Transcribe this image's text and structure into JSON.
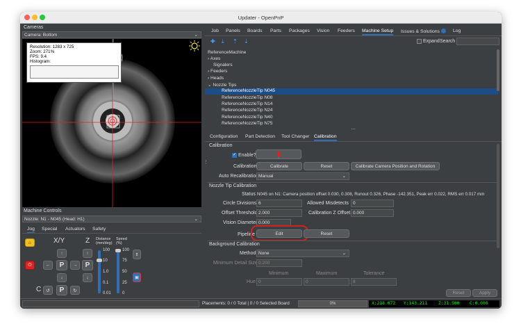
{
  "window": {
    "title": "Updater - OpenPnP"
  },
  "cameras": {
    "panel_label": "Cameras",
    "selected": "Camera: Bottom",
    "overlay": {
      "resolution": "Resolution: 1283 x 725",
      "zoom": "Zoom: 271%",
      "fps": "FPS: 9.4",
      "histogram": "Histogram:"
    }
  },
  "machine_controls": {
    "label": "Machine Controls",
    "nozzle": "Nozzle: N1 - N045 (Head: H1)",
    "tabs": [
      "Jog",
      "Special",
      "Actuators",
      "Safety"
    ],
    "xy": "X/Y",
    "z": "Z",
    "distance_label": "Distance\n(mm/deg)",
    "speed_label": "Speed\n(%)",
    "distance_ticks": [
      "100",
      "10",
      "1.0",
      "0.1",
      "0.01"
    ],
    "speed_ticks": [
      "100",
      "75",
      "50",
      "25",
      "0"
    ],
    "distance_value": 10,
    "speed_value": 100,
    "p": "P",
    "c": "C"
  },
  "top_tabs": [
    "Job",
    "Panels",
    "Boards",
    "Parts",
    "Packages",
    "Vision",
    "Feeders",
    "Machine Setup",
    "Issues & Solutions",
    "Log"
  ],
  "top_tab_selected": "Machine Setup",
  "toolbar": {
    "expand": "Expand",
    "search": "Search"
  },
  "tree": {
    "root": "ReferenceMachine",
    "items": [
      "Axes",
      "Signalers",
      "Feeders",
      "Heads",
      "Nozzle Tips"
    ],
    "nozzle_tips": [
      "ReferenceNozzleTip N045",
      "ReferenceNozzleTip N08",
      "ReferenceNozzleTip N14",
      "ReferenceNozzleTip N24",
      "ReferenceNozzleTip N40",
      "ReferenceNozzleTip N75"
    ],
    "selected": "ReferenceNozzleTip N045"
  },
  "sub_tabs": [
    "Configuration",
    "Part Detection",
    "Tool Changer",
    "Calibration"
  ],
  "sub_tab_selected": "Calibration",
  "calibration": {
    "title": "Calibration",
    "enable_label": "Enable?",
    "calibration_label": "Calibration",
    "calibrate": "Calibrate",
    "reset": "Reset",
    "calibrate_camera": "Calibrate Camera Position and Rotation",
    "auto_recal_label": "Auto Recalibration",
    "auto_recal_value": "Manual"
  },
  "nozzle_tip_calibration": {
    "title": "Nozzle Tip Calibration",
    "status_label": "Status",
    "status_value": "N045 on N1: Camera position offset 0.030, 0.308, Runout 0.326, Phase -142.351, Peak err 0.022, RMS err 0.017 mm",
    "circle_div_label": "Circle Divisions",
    "circle_div_value": "6",
    "allowed_mis_label": "Allowed Misdetects",
    "allowed_mis_value": "0",
    "offset_thr_label": "Offset Threshold",
    "offset_thr_value": "2.000",
    "cal_z_label": "Calibration Z Offset",
    "cal_z_value": "0.000",
    "vision_diam_label": "Vision Diameter",
    "vision_diam_value": "0.000",
    "pipeline_label": "Pipeline",
    "edit": "Edit",
    "reset": "Reset"
  },
  "background_calibration": {
    "title": "Background Calibration",
    "method_label": "Method",
    "method_value": "None",
    "min_detail_label": "Minimum Detail Size",
    "min_detail_value": "0.200",
    "minimum": "Minimum",
    "maximum": "Maximum",
    "tolerance": "Tolerance",
    "hue_label": "Hue",
    "hue_min": "0",
    "hue_max": "0",
    "hue_tol": "8"
  },
  "bottom_buttons": {
    "reset": "Reset",
    "apply": "Apply"
  },
  "status": {
    "placements": "Placements: 0 / 0 Total | 0 / 0 Selected Board",
    "progress": "0%",
    "x": "X:218.072",
    "y": "Y:143.211",
    "z": "Z:31.500",
    "c": "C:0.000"
  },
  "colors": {
    "accent": "#2f6fb8",
    "status_green": "#00ff00",
    "edit_highlight": "#d52020"
  }
}
